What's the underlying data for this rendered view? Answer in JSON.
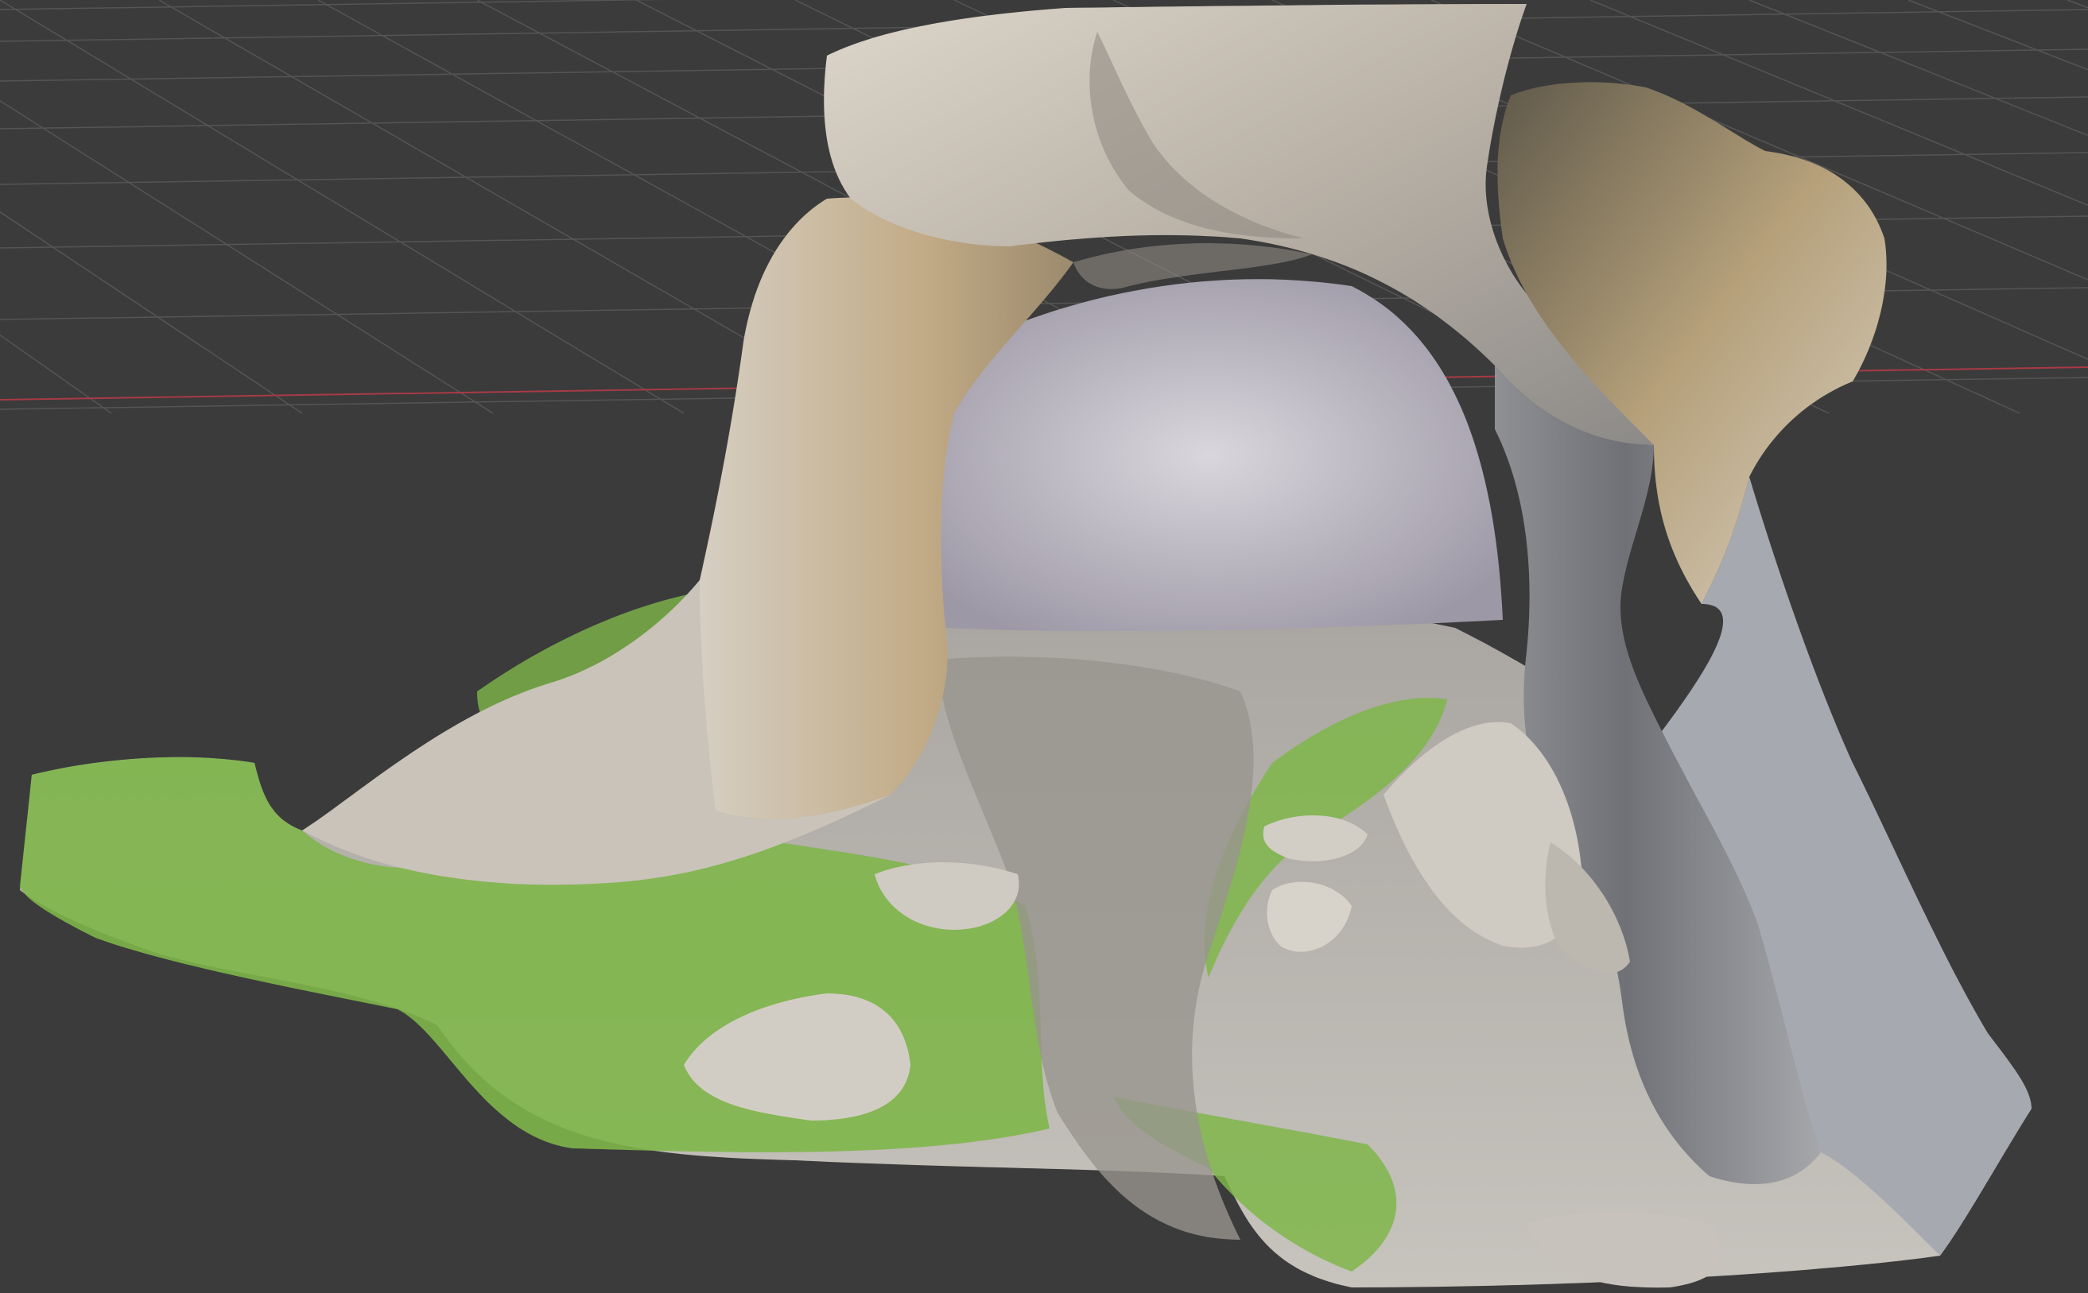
{
  "viewport": {
    "name": "3D Viewport",
    "background_color": "#3b3b3b",
    "grid_color": "#555555",
    "x_axis_color": "#a83a46",
    "y_axis_color": "#7fa83a"
  },
  "model": {
    "description_icon": "photogrammetry-mesh",
    "colors": {
      "rock_light": "#d7d1c7",
      "rock_mid": "#b8b0a3",
      "rock_shadow": "#7d7a78",
      "rock_dark": "#5f6166",
      "ochre": "#b9925b",
      "moss": "#7fb64a",
      "moss_dark": "#5d8f33",
      "path": "#9a9690",
      "cave_back": "#c9c6cf"
    }
  }
}
